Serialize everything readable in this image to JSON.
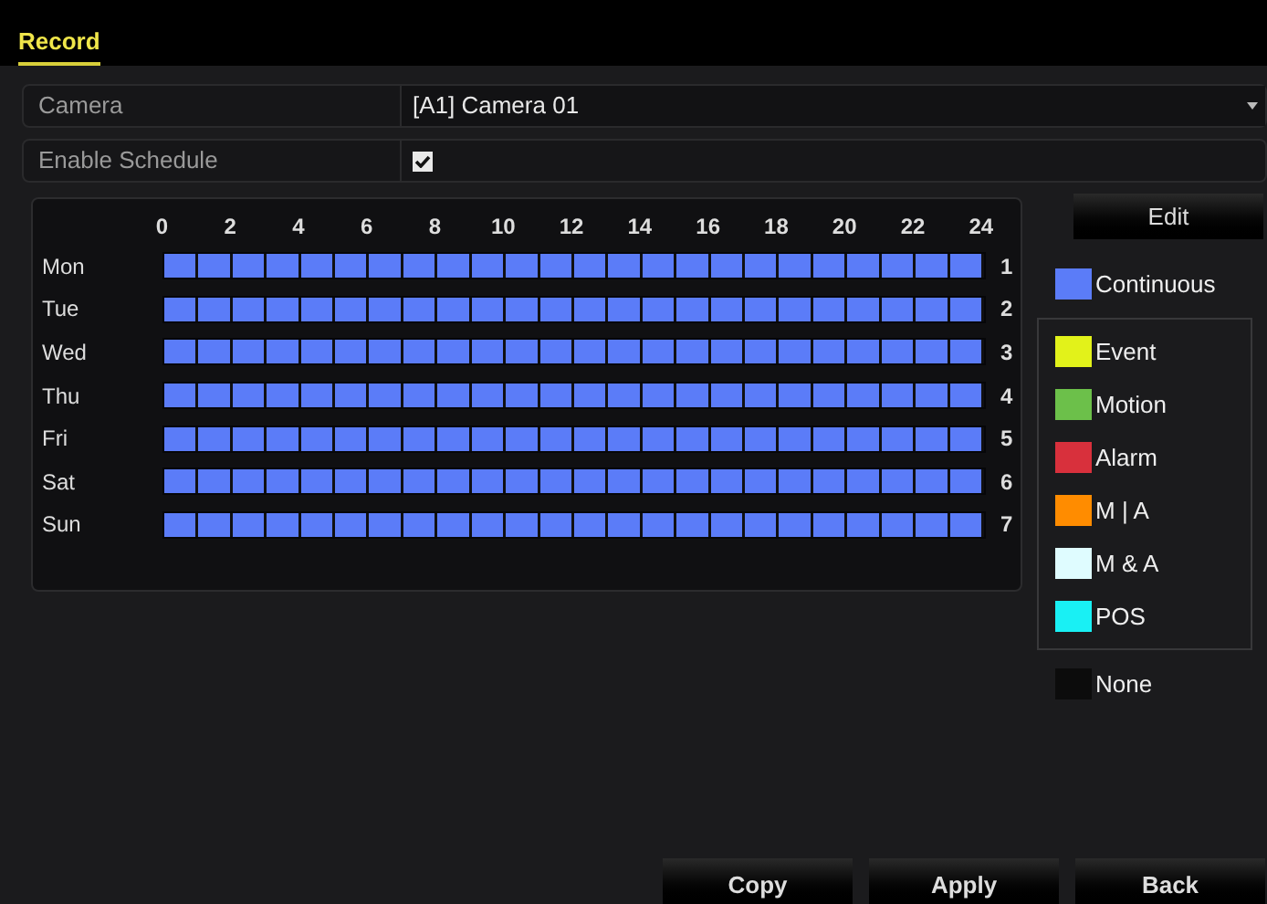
{
  "tabs": [
    {
      "label": "Record",
      "selected": true
    }
  ],
  "camera": {
    "label": "Camera",
    "value": "[A1] Camera 01"
  },
  "enable_schedule": {
    "label": "Enable Schedule",
    "checked": true
  },
  "schedule": {
    "hours": [
      "0",
      "2",
      "4",
      "6",
      "8",
      "10",
      "12",
      "14",
      "16",
      "18",
      "20",
      "22",
      "24"
    ],
    "rows": [
      {
        "day": "Mon",
        "number": "1",
        "level": 1
      },
      {
        "day": "Tue",
        "number": "2",
        "level": 1
      },
      {
        "day": "Wed",
        "number": "3",
        "level": 1
      },
      {
        "day": "Thu",
        "number": "4",
        "level": 1
      },
      {
        "day": "Fri",
        "number": "5",
        "level": 1
      },
      {
        "day": "Sat",
        "number": "6",
        "level": 1
      },
      {
        "day": "Sun",
        "number": "7",
        "level": 1
      }
    ]
  },
  "edit_button": "Edit",
  "legend": {
    "primary": {
      "label": "Continuous",
      "color": "#5b7cf8"
    },
    "events": [
      {
        "label": "Event",
        "color": "#e2f21a"
      },
      {
        "label": "Motion",
        "color": "#6cc04a"
      },
      {
        "label": "Alarm",
        "color": "#d8303c"
      },
      {
        "label": "M | A",
        "color": "#ff8c00"
      },
      {
        "label": "M & A",
        "color": "#dffcff"
      },
      {
        "label": "POS",
        "color": "#19f0f4"
      }
    ],
    "none": {
      "label": "None",
      "color": "#0c0c0c"
    }
  },
  "buttons": [
    "Copy",
    "Apply",
    "Back"
  ]
}
